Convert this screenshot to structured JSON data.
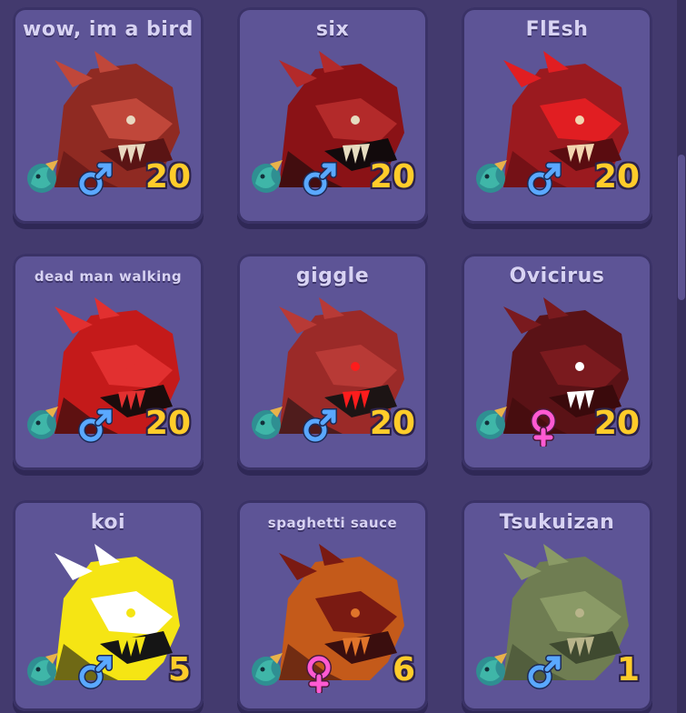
{
  "creatures": [
    {
      "name": "wow, im a bird",
      "gender": "male",
      "level": "20",
      "colors": {
        "main": "#8f2a22",
        "accent": "#c0473a",
        "dark": "#5a1414",
        "extra": "#e8d8c0"
      }
    },
    {
      "name": "six",
      "gender": "male",
      "level": "20",
      "colors": {
        "main": "#8a1216",
        "accent": "#b32a2a",
        "dark": "#120a0c",
        "extra": "#e6dcc0"
      }
    },
    {
      "name": "FlEsh",
      "gender": "male",
      "level": "20",
      "colors": {
        "main": "#9b1a1f",
        "accent": "#e11e22",
        "dark": "#5a0c10",
        "extra": "#f2d6b0"
      }
    },
    {
      "name": "dead man walking",
      "gender": "male",
      "level": "20",
      "colors": {
        "main": "#c41a1a",
        "accent": "#e23030",
        "dark": "#1a0c0c",
        "extra": "#e23030"
      }
    },
    {
      "name": "giggle",
      "gender": "male",
      "level": "20",
      "colors": {
        "main": "#9b2a28",
        "accent": "#b83a36",
        "dark": "#1c1414",
        "extra": "#ff1c1c"
      }
    },
    {
      "name": "Ovicirus",
      "gender": "female",
      "level": "20",
      "colors": {
        "main": "#5a1216",
        "accent": "#7a1a1e",
        "dark": "#3a0a0c",
        "extra": "#ffffff"
      }
    },
    {
      "name": "koi",
      "gender": "male",
      "level": "5",
      "colors": {
        "main": "#f5e514",
        "accent": "#ffffff",
        "dark": "#151515",
        "extra": "#f5e514"
      }
    },
    {
      "name": "spaghetti sauce",
      "gender": "female",
      "level": "6",
      "colors": {
        "main": "#c45a1a",
        "accent": "#7a1a12",
        "dark": "#3a0e0e",
        "extra": "#e0742a"
      }
    },
    {
      "name": "Tsukuizan",
      "gender": "male",
      "level": "1",
      "colors": {
        "main": "#6f7d52",
        "accent": "#8a9a66",
        "dark": "#3f4a30",
        "extra": "#b8b48a"
      }
    }
  ],
  "icons": {
    "species": "dragon-species-icon",
    "male": "male-symbol-icon",
    "female": "female-symbol-icon"
  },
  "theme": {
    "panel": "#433a6e",
    "card": "#5d5496",
    "level": "#ffcc2a",
    "male": "#5aa8ff",
    "female": "#ff5ad2"
  }
}
